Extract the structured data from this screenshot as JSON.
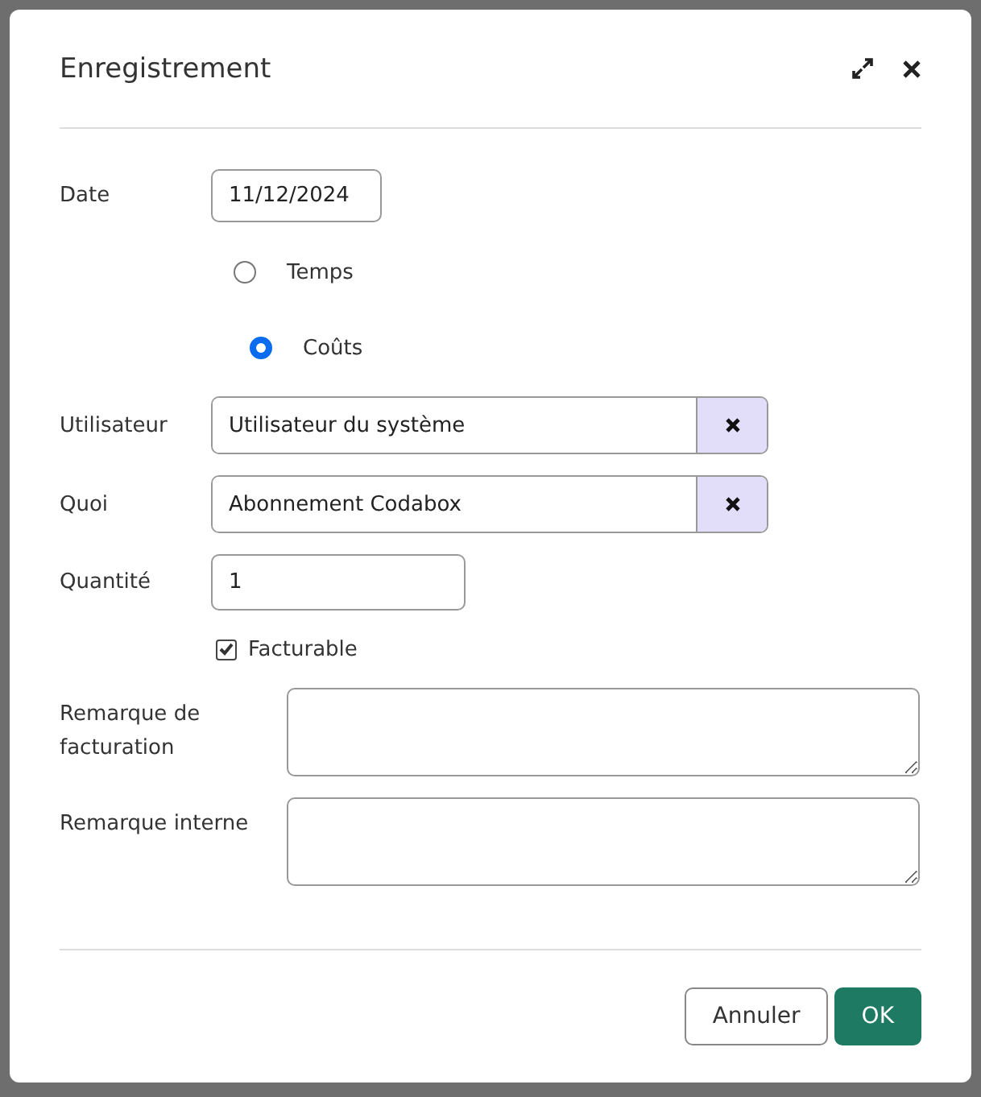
{
  "dialog": {
    "title": "Enregistrement",
    "date": {
      "label": "Date",
      "value": "11/12/2024"
    },
    "type_options": [
      {
        "label": "Temps",
        "selected": false
      },
      {
        "label": "Coûts",
        "selected": true
      }
    ],
    "user": {
      "label": "Utilisateur",
      "value": "Utilisateur du système"
    },
    "what": {
      "label": "Quoi",
      "value": "Abonnement Codabox"
    },
    "quantity": {
      "label": "Quantité",
      "value": "1"
    },
    "billable": {
      "label": "Facturable",
      "checked": true
    },
    "billing_remark": {
      "label": "Remarque de facturation"
    },
    "internal_remark": {
      "label": "Remarque interne"
    },
    "buttons": [
      {
        "label": "Annuler",
        "kind": "secondary"
      },
      {
        "label": "OK",
        "kind": "primary"
      }
    ]
  }
}
